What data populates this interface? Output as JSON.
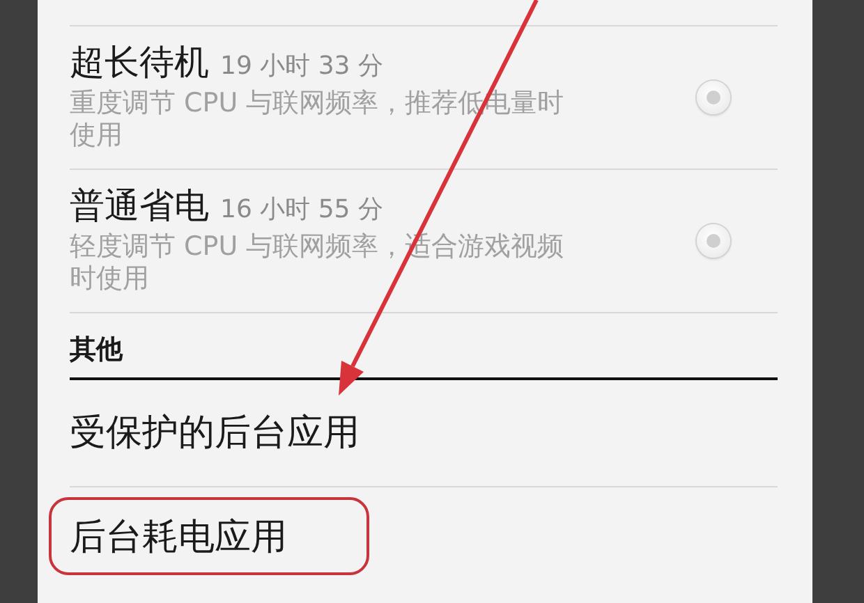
{
  "modes": [
    {
      "title": "超长待机",
      "duration": "19 小时 33 分",
      "description": "重度调节 CPU 与联网频率，推荐低电量时使用",
      "selected": false
    },
    {
      "title": "普通省电",
      "duration": "16 小时 55 分",
      "description": "轻度调节 CPU 与联网频率，适合游戏视频时使用",
      "selected": false
    }
  ],
  "section": {
    "title": "其他",
    "items": [
      {
        "label": "受保护的后台应用",
        "highlighted": false
      },
      {
        "label": "后台耗电应用",
        "highlighted": true
      }
    ]
  },
  "pointer_arrow": true
}
